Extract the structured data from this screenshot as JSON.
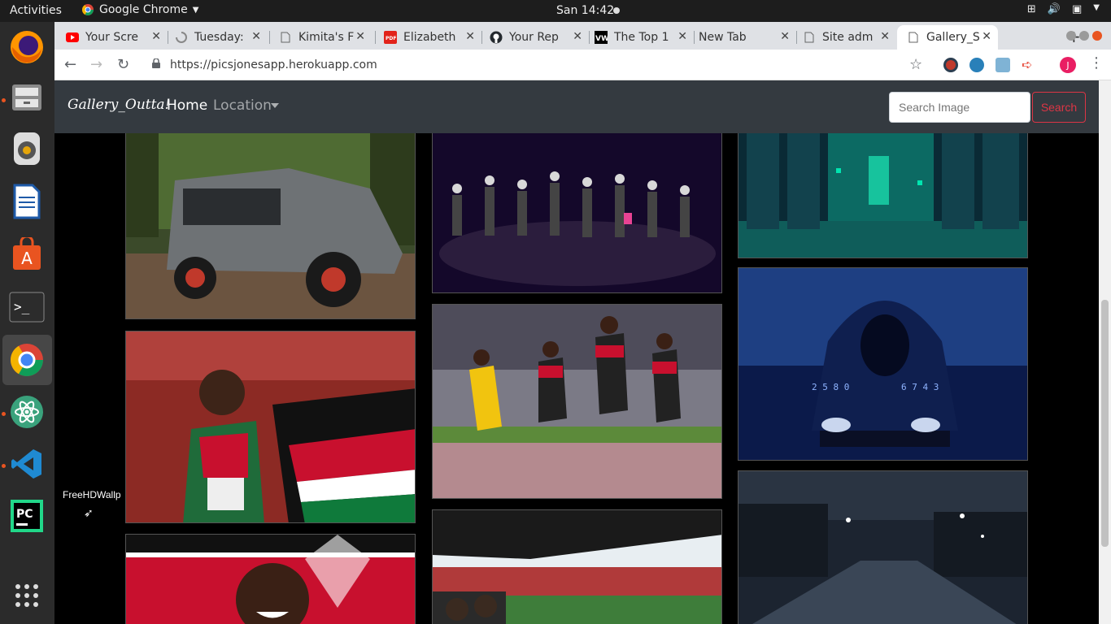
{
  "topbar": {
    "activities": "Activities",
    "app_name": "Google Chrome",
    "clock": "San 14:42"
  },
  "tabs": [
    {
      "title": "Your Scre",
      "icon": "youtube-icon"
    },
    {
      "title": "Tuesday:",
      "icon": "loading-icon"
    },
    {
      "title": "Kimita's F",
      "icon": "page-icon"
    },
    {
      "title": "Elizabeth",
      "icon": "pdf-icon"
    },
    {
      "title": "Your Rep",
      "icon": "github-icon"
    },
    {
      "title": "The Top 1",
      "icon": "vw-icon"
    },
    {
      "title": "New Tab",
      "icon": ""
    },
    {
      "title": "Site adm",
      "icon": "page-icon"
    },
    {
      "title": "Gallery_S",
      "icon": "page-icon"
    }
  ],
  "toolbar": {
    "url": "https://picsjonesapp.herokuapp.com",
    "profile_initial": "J"
  },
  "site": {
    "brand": "Gallery_Outta!",
    "nav_home": "Home",
    "nav_location": "Location",
    "search_placeholder": "Search Image",
    "search_button": "Search"
  },
  "gallery": [
    {
      "caption": "grey SUV in forest"
    },
    {
      "caption": "dancers on dark stage"
    },
    {
      "caption": "green server room"
    },
    {
      "caption": "athlete with Kenyan flag"
    },
    {
      "caption": "runners on track"
    },
    {
      "caption": "hooded hacker"
    },
    {
      "caption": "smiling man with flag"
    },
    {
      "caption": "football stadium"
    },
    {
      "caption": "night street"
    }
  ],
  "desktop": {
    "label": "FreeHDWallp"
  },
  "colors": {
    "navbar": "#343a40",
    "danger": "#dc3545",
    "ubuntu_orange": "#e95420"
  }
}
